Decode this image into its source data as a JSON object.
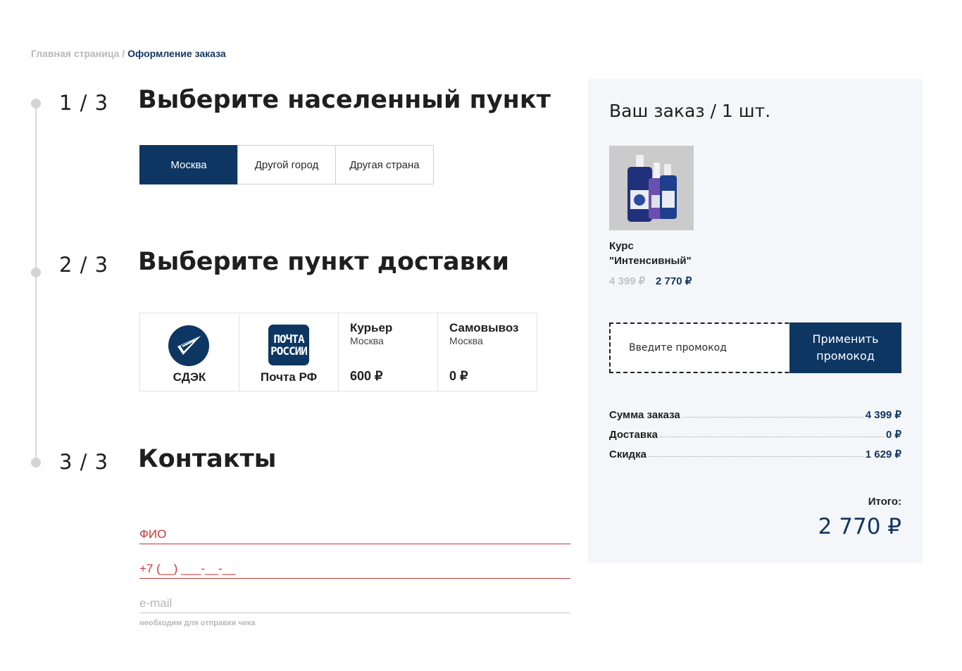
{
  "breadcrumb": {
    "home": "Главная страница",
    "separator": " / ",
    "current": "Оформление заказа"
  },
  "steps": [
    {
      "number": "1 / 3",
      "title": "Выберите населенный пункт"
    },
    {
      "number": "2 / 3",
      "title": "Выберите пункт доставки"
    },
    {
      "number": "3 / 3",
      "title": "Контакты"
    }
  ],
  "city_options": [
    {
      "label": "Москва",
      "selected": true
    },
    {
      "label": "Другой город",
      "selected": false
    },
    {
      "label": "Другая страна",
      "selected": false
    }
  ],
  "delivery_options": [
    {
      "name": "СДЭК",
      "logo": "cdek-logo"
    },
    {
      "name": "Почта РФ",
      "logo": "pochta-rossii-logo",
      "logo_text_1": "ПОЧТА",
      "logo_text_2": "РОССИИ"
    },
    {
      "title": "Курьер",
      "city": "Москва",
      "price": "600 ₽"
    },
    {
      "title": "Самовывоз",
      "city": "Москва",
      "price": "0 ₽"
    }
  ],
  "contacts": {
    "name_placeholder": "ФИО",
    "phone_placeholder": "+7 (__) ___-__-__",
    "email_placeholder": "e-mail",
    "email_hint": "необходим для отправки чека"
  },
  "order": {
    "title": "Ваш заказ / 1 шт.",
    "product": {
      "name_line1": "Курс",
      "name_line2": "\"Интенсивный\"",
      "old_price": "4 399 ₽",
      "new_price": "2 770 ₽"
    },
    "promo": {
      "placeholder": "Введите промокод",
      "button_label": "Применить промокод"
    },
    "summary": [
      {
        "label": "Сумма заказа",
        "value": "4 399 ₽"
      },
      {
        "label": "Доставка",
        "value": "0 ₽"
      },
      {
        "label": "Скидка",
        "value": "1 629 ₽"
      }
    ],
    "total_label": "Итого:",
    "total_value": "2 770 ₽"
  },
  "colors": {
    "brand_navy": "#0e3663",
    "error_red": "#c93737",
    "panel_bg": "#f4f6f9"
  }
}
